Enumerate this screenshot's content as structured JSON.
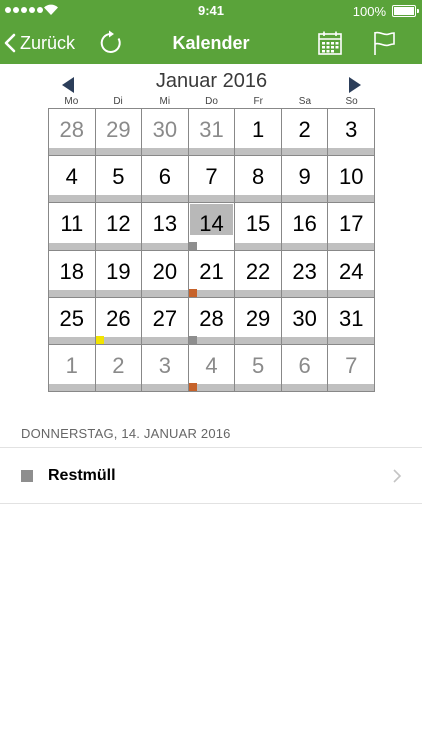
{
  "status": {
    "time": "9:41",
    "battery": "100%"
  },
  "nav": {
    "back_label": "Zurück",
    "title": "Kalender"
  },
  "calendar": {
    "month_title": "Januar 2016",
    "weekdays": [
      "Mo",
      "Di",
      "Mi",
      "Do",
      "Fr",
      "Sa",
      "So"
    ],
    "days": [
      {
        "d": "28",
        "outside": true
      },
      {
        "d": "29",
        "outside": true
      },
      {
        "d": "30",
        "outside": true
      },
      {
        "d": "31",
        "outside": true
      },
      {
        "d": "1"
      },
      {
        "d": "2"
      },
      {
        "d": "3"
      },
      {
        "d": "4"
      },
      {
        "d": "5"
      },
      {
        "d": "6"
      },
      {
        "d": "7"
      },
      {
        "d": "8"
      },
      {
        "d": "9"
      },
      {
        "d": "10"
      },
      {
        "d": "11"
      },
      {
        "d": "12"
      },
      {
        "d": "13"
      },
      {
        "d": "14",
        "selected": true,
        "marker": "#8e8e8e"
      },
      {
        "d": "15"
      },
      {
        "d": "16"
      },
      {
        "d": "17"
      },
      {
        "d": "18"
      },
      {
        "d": "19"
      },
      {
        "d": "20"
      },
      {
        "d": "21",
        "marker": "#c6622a"
      },
      {
        "d": "22"
      },
      {
        "d": "23"
      },
      {
        "d": "24"
      },
      {
        "d": "25"
      },
      {
        "d": "26",
        "marker": "#f2e400"
      },
      {
        "d": "27"
      },
      {
        "d": "28",
        "marker": "#8e8e8e"
      },
      {
        "d": "29"
      },
      {
        "d": "30"
      },
      {
        "d": "31"
      },
      {
        "d": "1",
        "outside": true
      },
      {
        "d": "2",
        "outside": true
      },
      {
        "d": "3",
        "outside": true
      },
      {
        "d": "4",
        "outside": true,
        "marker": "#c6622a"
      },
      {
        "d": "5",
        "outside": true
      },
      {
        "d": "6",
        "outside": true
      },
      {
        "d": "7",
        "outside": true
      }
    ]
  },
  "detail": {
    "day_header": "DONNERSTAG, 14. JANUAR 2016",
    "events": [
      {
        "label": "Restmüll",
        "color": "#8e8e8e"
      }
    ]
  },
  "colors": {
    "brand": "#5aa33a",
    "arrow": "#2c3e5a"
  }
}
